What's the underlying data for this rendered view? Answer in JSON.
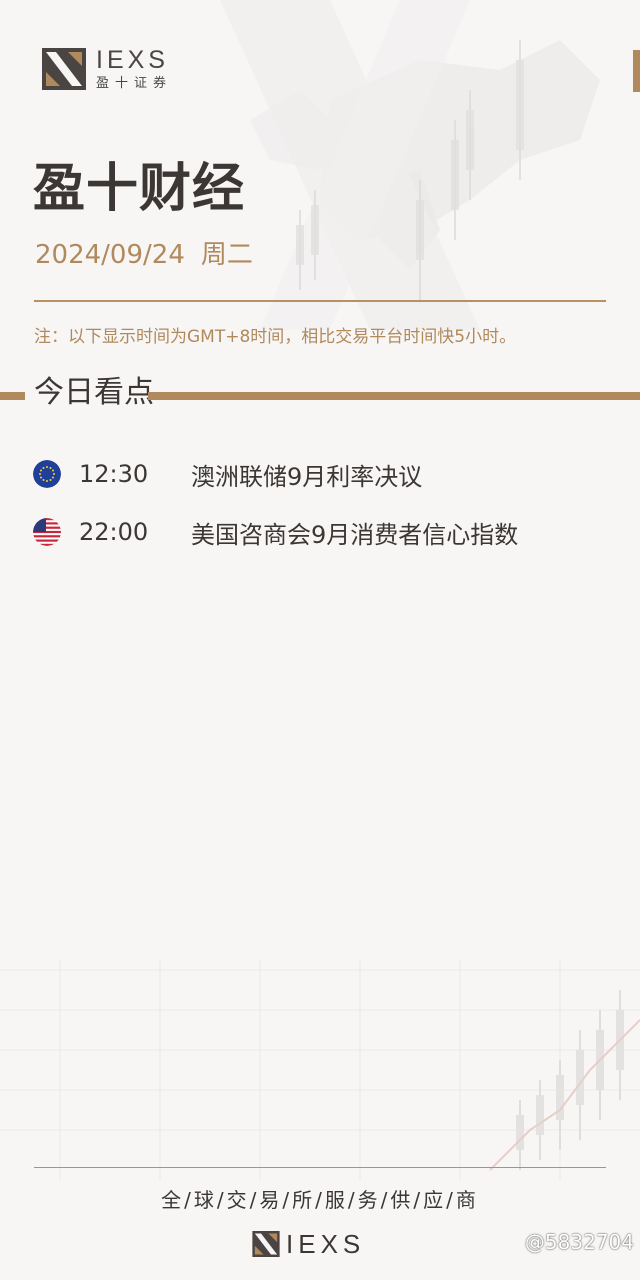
{
  "brand": {
    "logo_word": "IEXS",
    "logo_sub": "盈十证券"
  },
  "header": {
    "title": "盈十财经",
    "date": "2024/09/24",
    "weekday": "周二",
    "note": "注：以下显示时间为GMT+8时间，相比交易平台时间快5小时。"
  },
  "section": {
    "title": "今日看点"
  },
  "events": [
    {
      "flag_icon": "eu-flag-icon",
      "time": "12:30",
      "title": "澳洲联储9月利率决议"
    },
    {
      "flag_icon": "us-flag-icon",
      "time": "22:00",
      "title": "美国咨商会9月消费者信心指数"
    }
  ],
  "footer": {
    "slogan": "全/球/交/易/所/服/务/供/应/商",
    "logo_word": "IEXS"
  },
  "watermark": {
    "text": "@5832704"
  },
  "colors": {
    "accent_gold": "#b0895c",
    "text_dark": "#3c3734",
    "background": "#f7f6f5"
  }
}
